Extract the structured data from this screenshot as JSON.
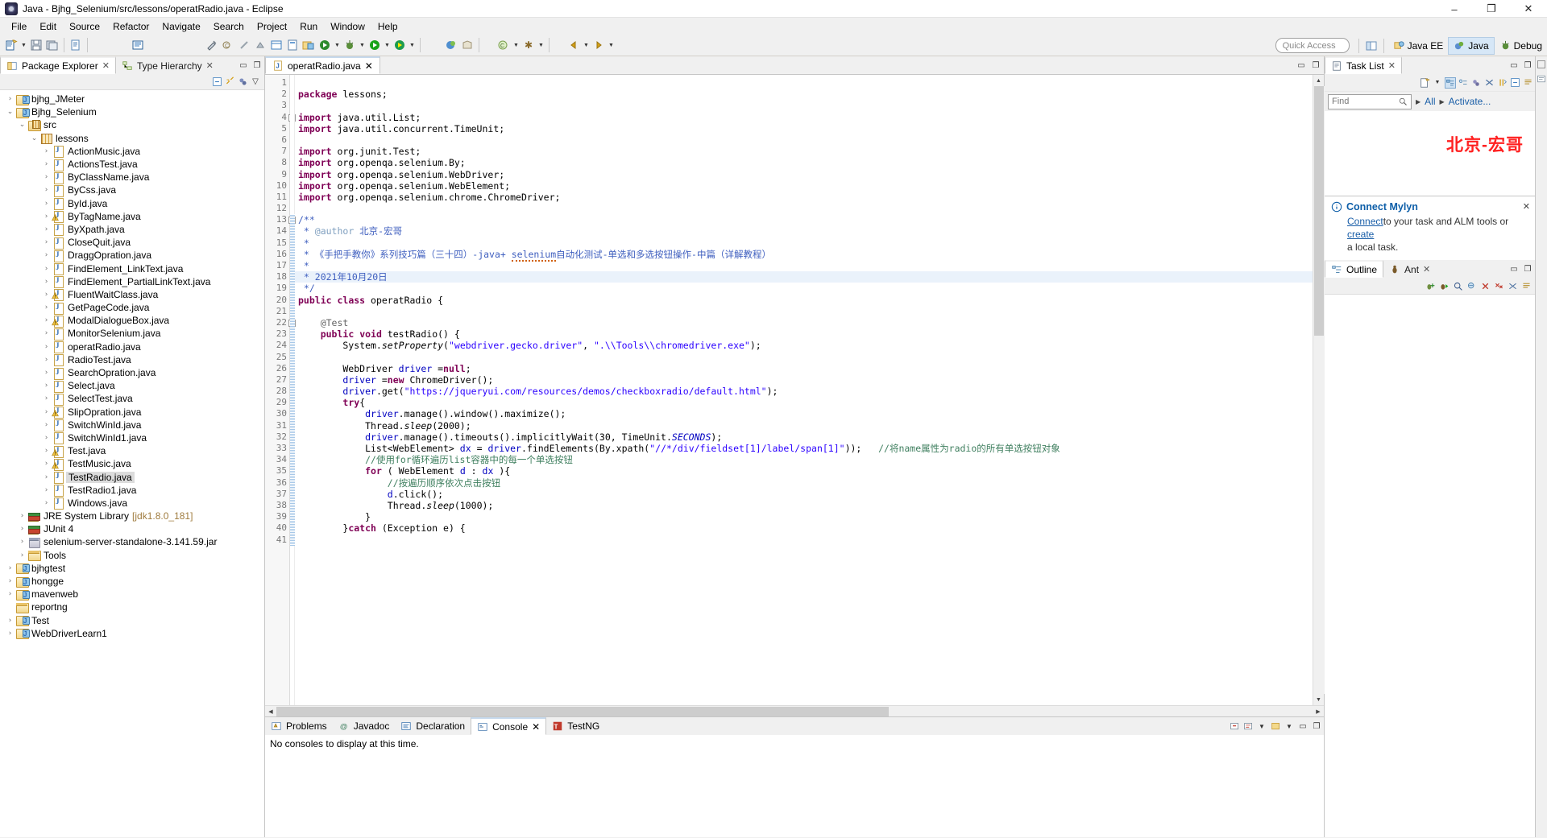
{
  "window": {
    "title": "Java - Bjhg_Selenium/src/lessons/operatRadio.java - Eclipse",
    "app_icon": "eclipse-icon",
    "minimize": "–",
    "maximize": "❐",
    "close": "✕"
  },
  "menu": [
    "File",
    "Edit",
    "Source",
    "Refactor",
    "Navigate",
    "Search",
    "Project",
    "Run",
    "Window",
    "Help"
  ],
  "toolbar": {
    "quick_access_placeholder": "Quick Access",
    "perspectives": [
      {
        "label": "Java EE",
        "active": false,
        "icon": "javaee-perspective-icon"
      },
      {
        "label": "Java",
        "active": true,
        "icon": "java-perspective-icon"
      },
      {
        "label": "Debug",
        "active": false,
        "icon": "debug-perspective-icon"
      }
    ],
    "open_perspective_icon": "open-perspective-icon"
  },
  "left_panel": {
    "tabs": [
      {
        "label": "Package Explorer",
        "active": true,
        "icon": "package-explorer-icon",
        "closable": true
      },
      {
        "label": "Type Hierarchy",
        "active": false,
        "icon": "type-hierarchy-icon",
        "closable": true
      }
    ],
    "minimize_icon": "minimize-icon",
    "maximize_icon": "maximize-icon",
    "view_toolbar": [
      "collapse-all-icon",
      "link-with-editor-icon",
      "focus-on-active-task-icon",
      "view-menu-icon"
    ],
    "tree": [
      {
        "label": "bjhg_JMeter",
        "indent": 0,
        "twist": "collapsed",
        "icon": "java-project-folder-icon"
      },
      {
        "label": "Bjhg_Selenium",
        "indent": 0,
        "twist": "expanded",
        "icon": "java-project-folder-icon"
      },
      {
        "label": "src",
        "indent": 1,
        "twist": "expanded",
        "icon": "source-folder-icon"
      },
      {
        "label": "lessons",
        "indent": 2,
        "twist": "expanded",
        "icon": "package-icon"
      },
      {
        "label": "ActionMusic.java",
        "indent": 3,
        "twist": "collapsed",
        "icon": "java-file-icon"
      },
      {
        "label": "ActionsTest.java",
        "indent": 3,
        "twist": "collapsed",
        "icon": "java-file-icon"
      },
      {
        "label": "ByClassName.java",
        "indent": 3,
        "twist": "collapsed",
        "icon": "java-file-icon"
      },
      {
        "label": "ByCss.java",
        "indent": 3,
        "twist": "collapsed",
        "icon": "java-file-icon"
      },
      {
        "label": "ById.java",
        "indent": 3,
        "twist": "collapsed",
        "icon": "java-file-icon"
      },
      {
        "label": "ByTagName.java",
        "indent": 3,
        "twist": "collapsed",
        "icon": "java-file-warning-icon"
      },
      {
        "label": "ByXpath.java",
        "indent": 3,
        "twist": "collapsed",
        "icon": "java-file-icon"
      },
      {
        "label": "CloseQuit.java",
        "indent": 3,
        "twist": "collapsed",
        "icon": "java-file-icon"
      },
      {
        "label": "DraggOpration.java",
        "indent": 3,
        "twist": "collapsed",
        "icon": "java-file-icon"
      },
      {
        "label": "FindElement_LinkText.java",
        "indent": 3,
        "twist": "collapsed",
        "icon": "java-file-icon"
      },
      {
        "label": "FindElement_PartialLinkText.java",
        "indent": 3,
        "twist": "collapsed",
        "icon": "java-file-icon"
      },
      {
        "label": "FluentWaitClass.java",
        "indent": 3,
        "twist": "collapsed",
        "icon": "java-file-warning-icon"
      },
      {
        "label": "GetPageCode.java",
        "indent": 3,
        "twist": "collapsed",
        "icon": "java-file-icon"
      },
      {
        "label": "ModalDialogueBox.java",
        "indent": 3,
        "twist": "collapsed",
        "icon": "java-file-warning-icon"
      },
      {
        "label": "MonitorSelenium.java",
        "indent": 3,
        "twist": "collapsed",
        "icon": "java-file-icon"
      },
      {
        "label": "operatRadio.java",
        "indent": 3,
        "twist": "collapsed",
        "icon": "java-file-icon"
      },
      {
        "label": "RadioTest.java",
        "indent": 3,
        "twist": "collapsed",
        "icon": "java-file-icon"
      },
      {
        "label": "SearchOpration.java",
        "indent": 3,
        "twist": "collapsed",
        "icon": "java-file-icon"
      },
      {
        "label": "Select.java",
        "indent": 3,
        "twist": "collapsed",
        "icon": "java-file-icon"
      },
      {
        "label": "SelectTest.java",
        "indent": 3,
        "twist": "collapsed",
        "icon": "java-file-icon"
      },
      {
        "label": "SlipOpration.java",
        "indent": 3,
        "twist": "collapsed",
        "icon": "java-file-warning-icon"
      },
      {
        "label": "SwitchWinId.java",
        "indent": 3,
        "twist": "collapsed",
        "icon": "java-file-icon"
      },
      {
        "label": "SwitchWinId1.java",
        "indent": 3,
        "twist": "collapsed",
        "icon": "java-file-icon"
      },
      {
        "label": "Test.java",
        "indent": 3,
        "twist": "collapsed",
        "icon": "java-file-warning-icon"
      },
      {
        "label": "TestMusic.java",
        "indent": 3,
        "twist": "collapsed",
        "icon": "java-file-warning-icon"
      },
      {
        "label": "TestRadio.java",
        "indent": 3,
        "twist": "collapsed",
        "icon": "java-file-icon",
        "selected": true
      },
      {
        "label": "TestRadio1.java",
        "indent": 3,
        "twist": "collapsed",
        "icon": "java-file-icon"
      },
      {
        "label": "Windows.java",
        "indent": 3,
        "twist": "collapsed",
        "icon": "java-file-icon"
      },
      {
        "label": "JRE System Library",
        "sublabel": "[jdk1.8.0_181]",
        "indent": 1,
        "twist": "collapsed",
        "icon": "library-icon"
      },
      {
        "label": "JUnit 4",
        "indent": 1,
        "twist": "collapsed",
        "icon": "library-icon"
      },
      {
        "label": "selenium-server-standalone-3.141.59.jar",
        "indent": 1,
        "twist": "collapsed",
        "icon": "jar-icon"
      },
      {
        "label": "Tools",
        "indent": 1,
        "twist": "collapsed",
        "icon": "folder-icon"
      },
      {
        "label": "bjhgtest",
        "indent": 0,
        "twist": "collapsed",
        "icon": "java-project-folder-icon"
      },
      {
        "label": "hongge",
        "indent": 0,
        "twist": "collapsed",
        "icon": "java-project-folder-icon"
      },
      {
        "label": "mavenweb",
        "indent": 0,
        "twist": "collapsed",
        "icon": "java-project-folder-icon"
      },
      {
        "label": "reportng",
        "indent": 0,
        "twist": "none",
        "icon": "folder-icon"
      },
      {
        "label": "Test",
        "indent": 0,
        "twist": "collapsed",
        "icon": "java-project-folder-icon"
      },
      {
        "label": "WebDriverLearn1",
        "indent": 0,
        "twist": "collapsed",
        "icon": "java-project-folder-icon"
      }
    ]
  },
  "editor": {
    "tab": {
      "label": "operatRadio.java",
      "icon": "java-file-icon",
      "closable": true
    },
    "minimize_icon": "minimize-icon",
    "maximize_icon": "maximize-icon",
    "first_line": 1,
    "last_visible_line": 41,
    "highlighted_line": 18,
    "code_lines": [
      {
        "n": 1,
        "html": ""
      },
      {
        "n": 2,
        "html": "<span class=\"kw\">package</span> lessons;"
      },
      {
        "n": 3,
        "html": ""
      },
      {
        "n": 4,
        "html": "<span class=\"kw\">import</span> java.util.List;",
        "fold": "collapse"
      },
      {
        "n": 5,
        "html": "<span class=\"kw\">import</span> java.util.concurrent.TimeUnit;"
      },
      {
        "n": 6,
        "html": ""
      },
      {
        "n": 7,
        "html": "<span class=\"kw\">import</span> org.junit.Test;"
      },
      {
        "n": 8,
        "html": "<span class=\"kw\">import</span> org.openqa.selenium.By;"
      },
      {
        "n": 9,
        "html": "<span class=\"kw\">import</span> org.openqa.selenium.WebDriver;"
      },
      {
        "n": 10,
        "html": "<span class=\"kw\">import</span> org.openqa.selenium.WebElement;"
      },
      {
        "n": 11,
        "html": "<span class=\"kw\">import</span> org.openqa.selenium.chrome.ChromeDriver;"
      },
      {
        "n": 12,
        "html": ""
      },
      {
        "n": 13,
        "html": "<span class=\"jdoc\">/**</span>",
        "fold": "collapse"
      },
      {
        "n": 14,
        "html": "<span class=\"jdoc\"> * </span><span class=\"jdtag\">@author</span><span class=\"jdoc\"> 北京-宏哥</span>"
      },
      {
        "n": 15,
        "html": "<span class=\"jdoc\"> *</span>"
      },
      {
        "n": 16,
        "html": "<span class=\"jdoc\"> * 《手把手教你》系列技巧篇（三十四）-java+ <span class=\"spell\">selenium</span>自动化测试-单选和多选按钮操作-中篇（详解教程）</span>"
      },
      {
        "n": 17,
        "html": "<span class=\"jdoc\"> *</span>"
      },
      {
        "n": 18,
        "html": "<span class=\"jdoc\"> * 2021年10月20日</span>",
        "hl": true
      },
      {
        "n": 19,
        "html": "<span class=\"jdoc\"> */</span>"
      },
      {
        "n": 20,
        "html": "<span class=\"kw\">public</span> <span class=\"kw\">class</span> operatRadio {"
      },
      {
        "n": 21,
        "html": ""
      },
      {
        "n": 22,
        "html": "    <span class=\"anno\">@Test</span>",
        "fold": "collapse"
      },
      {
        "n": 23,
        "html": "    <span class=\"kw\">public</span> <span class=\"kw\">void</span> testRadio() {"
      },
      {
        "n": 24,
        "html": "        System.<span class=\"stat\">setProperty</span>(<span class=\"str\">\"webdriver.gecko.driver\"</span>, <span class=\"str\">\".\\\\Tools\\\\chromedriver.exe\"</span>);"
      },
      {
        "n": 25,
        "html": ""
      },
      {
        "n": 26,
        "html": "        WebDriver <span class=\"fld\">driver</span> =<span class=\"kw\">null</span>;"
      },
      {
        "n": 27,
        "html": "        <span class=\"fld\">driver</span> =<span class=\"kw\">new</span> ChromeDriver();"
      },
      {
        "n": 28,
        "html": "        <span class=\"fld\">driver</span>.get(<span class=\"str\">\"https://jqueryui.com/resources/demos/checkboxradio/default.html\"</span>);"
      },
      {
        "n": 29,
        "html": "        <span class=\"kw\">try</span>{"
      },
      {
        "n": 30,
        "html": "            <span class=\"fld\">driver</span>.manage().window().maximize();"
      },
      {
        "n": 31,
        "html": "            Thread.<span class=\"stat\">sleep</span>(2000);"
      },
      {
        "n": 32,
        "html": "            <span class=\"fld\">driver</span>.manage().timeouts().implicitlyWait(30, TimeUnit.<span class=\"statf\">SECONDS</span>);"
      },
      {
        "n": 33,
        "html": "            List&lt;WebElement&gt; <span class=\"fld\">dx</span> = <span class=\"fld\">driver</span>.findElements(By.xpath(<span class=\"str\">\"//*/div/fieldset[1]/label/span[1]\"</span>));   <span class=\"cmt\">//将name属性为radio的所有单选按钮对象</span>"
      },
      {
        "n": 34,
        "html": "            <span class=\"cmt\">//使用for循环遍历list容器中的每一个单选按钮</span>"
      },
      {
        "n": 35,
        "html": "            <span class=\"kw\">for</span> ( WebElement <span class=\"fld\">d</span> : <span class=\"fld\">dx</span> ){"
      },
      {
        "n": 36,
        "html": "                <span class=\"cmt\">//按遍历顺序依次点击按钮</span>"
      },
      {
        "n": 37,
        "html": "                <span class=\"fld\">d</span>.click();"
      },
      {
        "n": 38,
        "html": "                Thread.<span class=\"stat\">sleep</span>(1000);"
      },
      {
        "n": 39,
        "html": "            }"
      },
      {
        "n": 40,
        "html": "        }<span class=\"kw\">catch</span> (Exception e) {"
      },
      {
        "n": 41,
        "html": ""
      }
    ]
  },
  "bottom": {
    "tabs": [
      {
        "label": "Problems",
        "active": false,
        "icon": "problems-icon",
        "closable": false
      },
      {
        "label": "Javadoc",
        "active": false,
        "icon": "javadoc-icon",
        "closable": false
      },
      {
        "label": "Declaration",
        "active": false,
        "icon": "declaration-icon",
        "closable": false
      },
      {
        "label": "Console",
        "active": true,
        "icon": "console-icon",
        "closable": true
      },
      {
        "label": "TestNG",
        "active": false,
        "icon": "testng-icon",
        "closable": false
      }
    ],
    "console_message": "No consoles to display at this time.",
    "tools": [
      "terminate-icon",
      "remove-launch-icon",
      "display-selected-console-icon",
      "open-console-icon",
      "minimize-icon",
      "maximize-icon"
    ]
  },
  "right_panel": {
    "tasklist": {
      "tab_label": "Task List",
      "tab_icon": "task-list-icon",
      "closable": true,
      "toolbar": [
        "new-task-icon",
        "dropdown-arrow",
        "categorized-presentation-icon",
        "scheduled-presentation-icon",
        "focus-on-workweek-icon",
        "filter-completed-icon",
        "synchronize-changed-icon",
        "collapse-all-icon",
        "view-menu-icon"
      ],
      "find_placeholder": "Find",
      "search_icon": "search-icon",
      "filter_all_label": "All",
      "filter_activate_label": "Activate...",
      "watermark": "北京-宏哥"
    },
    "mylyn": {
      "title": "Connect Mylyn",
      "title_icon": "info-icon",
      "text_before": "to your task and ALM tools or ",
      "link_connect": "Connect",
      "link_create": "create",
      "text_after": "a local task.",
      "close_icon": "close-icon"
    },
    "outline": {
      "tabs": [
        {
          "label": "Outline",
          "active": true,
          "icon": "outline-icon",
          "closable": false
        },
        {
          "label": "Ant",
          "active": false,
          "icon": "ant-icon",
          "closable": true
        }
      ],
      "toolbar": [
        "add-buildfile-icon",
        "run-default-target-icon",
        "search-buildfiles-icon",
        "hide-internal-targets-icon",
        "remove-icon",
        "remove-all-icon",
        "filter-icon",
        "view-menu-icon"
      ],
      "minimize_icon": "minimize-icon",
      "maximize_icon": "maximize-icon"
    }
  }
}
